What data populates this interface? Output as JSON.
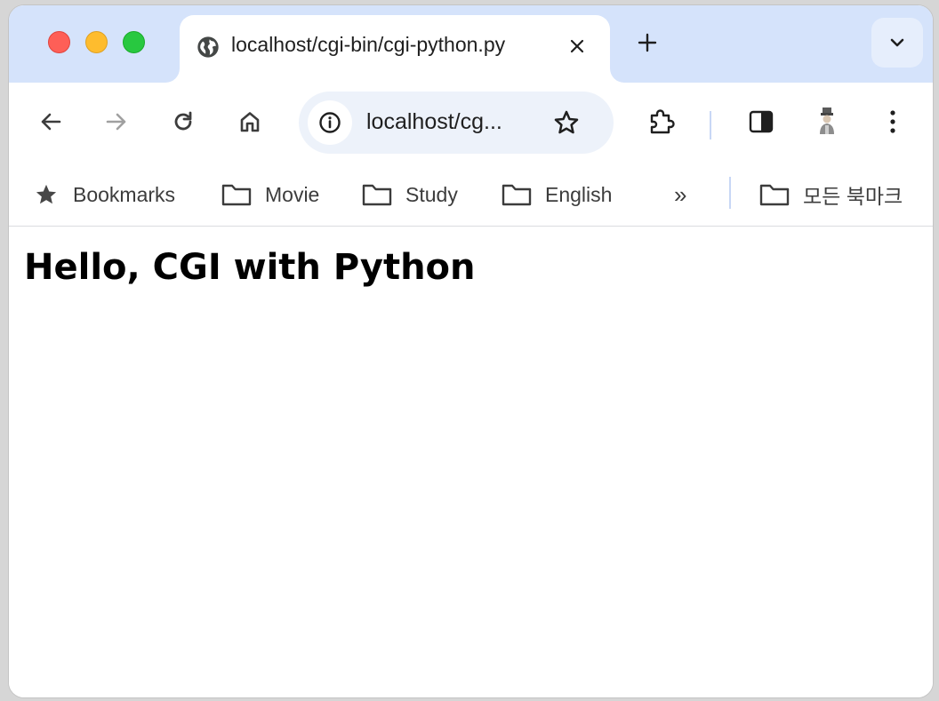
{
  "window": {
    "controls": [
      "close",
      "minimize",
      "maximize"
    ]
  },
  "tab": {
    "title": "localhost/cgi-bin/cgi-python.py",
    "favicon": "globe-icon"
  },
  "toolbar": {
    "back": "back-arrow-icon",
    "forward": "forward-arrow-icon",
    "reload": "reload-icon",
    "home": "home-icon",
    "url_display": "localhost/cg...",
    "extensions": "puzzle-icon",
    "side_panel": "side-panel-icon",
    "profile": "profile-avatar-icon",
    "menu": "kebab-menu-icon"
  },
  "bookmarks": {
    "items": [
      {
        "label": "Bookmarks",
        "icon": "star-icon"
      },
      {
        "label": "Movie",
        "icon": "folder-icon"
      },
      {
        "label": "Study",
        "icon": "folder-icon"
      },
      {
        "label": "English",
        "icon": "folder-icon"
      }
    ],
    "overflow": "»",
    "all_bookmarks": "모든 북마크"
  },
  "content": {
    "heading": "Hello, CGI with Python"
  },
  "colors": {
    "tabstrip": "#d5e3fb",
    "omnibox": "#edf2fa",
    "close": "#fe5f57",
    "minimize": "#febc2e",
    "maximize": "#28c840"
  }
}
